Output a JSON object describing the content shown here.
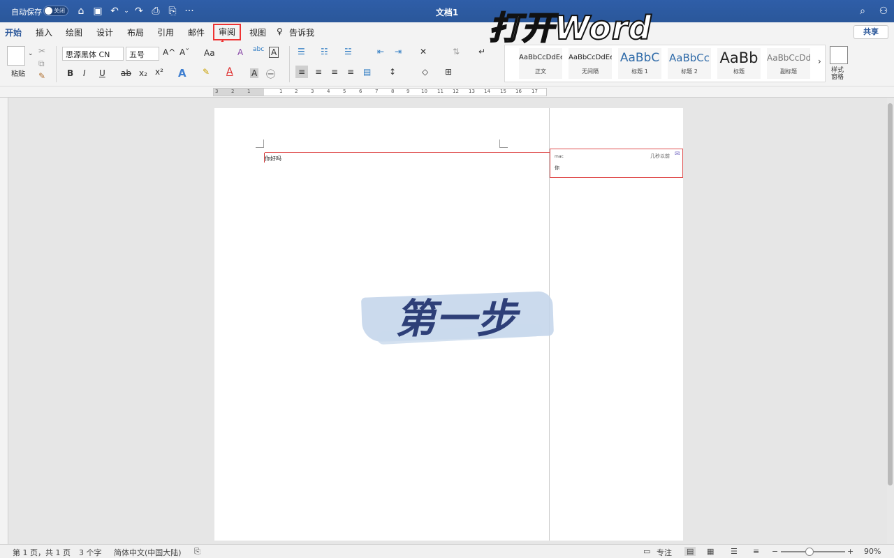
{
  "titlebar": {
    "autosave_label": "自动保存",
    "toggle_label": "关闭",
    "document_title": "文档1",
    "more": "···"
  },
  "tabs": [
    "开始",
    "插入",
    "绘图",
    "设计",
    "布局",
    "引用",
    "邮件",
    "审阅",
    "视图"
  ],
  "tell_me": "告诉我",
  "share_label": "共享",
  "ribbon": {
    "paste_label": "粘贴",
    "font_name": "思源黑体 CN",
    "font_size": "五号",
    "grow_font": "A^",
    "shrink_font": "Aˇ",
    "change_case": "Aa",
    "bold": "B",
    "italic": "I",
    "underline": "U",
    "strike": "ab",
    "subscript": "x₂",
    "superscript": "x²",
    "styles_pane_label": "样式\n窗格",
    "styles": [
      {
        "preview": "AaBbCcDdEe",
        "name": "正文"
      },
      {
        "preview": "AaBbCcDdEe",
        "name": "无间隔"
      },
      {
        "preview": "AaBbC",
        "name": "标题 1"
      },
      {
        "preview": "AaBbCc",
        "name": "标题 2"
      },
      {
        "preview": "AaBb",
        "name": "标题"
      },
      {
        "preview": "AaBbCcDd",
        "name": "副标题"
      }
    ],
    "styles_more": "›"
  },
  "ruler_numbers": [
    "3",
    "2",
    "1",
    "1",
    "2",
    "3",
    "4",
    "5",
    "6",
    "7",
    "8",
    "9",
    "10",
    "11",
    "12",
    "13",
    "14",
    "15",
    "16",
    "17"
  ],
  "document": {
    "body_text": "你好吗",
    "comment_author": "mac",
    "comment_time": "几秒以前",
    "comment_text": "你"
  },
  "statusbar": {
    "page": "第 1 页，共 1 页",
    "words": "3 个字",
    "language": "简体中文(中国大陆)",
    "focus": "专注",
    "zoom": "90%"
  },
  "overlay": {
    "title": "打开Word",
    "step": "第一步"
  },
  "colors": {
    "titlebar": "#2b579a",
    "highlight_box": "#e33333",
    "step_text": "#2e3f78",
    "brush": "#c2d4ea"
  }
}
